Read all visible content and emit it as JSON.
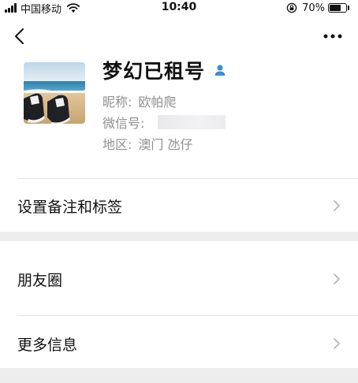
{
  "status_bar": {
    "carrier": "中国移动",
    "time": "10:40",
    "battery": "70%",
    "battery_level": 0.7
  },
  "nav": {
    "back_icon": "chevron-left-icon",
    "more_icon": "more-dots-icon"
  },
  "profile": {
    "display_name": "梦幻已租号",
    "nickname_label": "昵称:",
    "nickname": "欧帕爬",
    "wechat_id_label": "微信号:",
    "region_label": "地区:",
    "region": "澳门 氹仔",
    "gender_icon": "male-user-icon",
    "accent_color": "#3d8fd6"
  },
  "rows": {
    "remark": "设置备注和标签",
    "moments": "朋友圈",
    "more_info": "更多信息"
  },
  "colors": {
    "gap_background": "#ededed",
    "secondary_text": "#8f8f8f"
  }
}
